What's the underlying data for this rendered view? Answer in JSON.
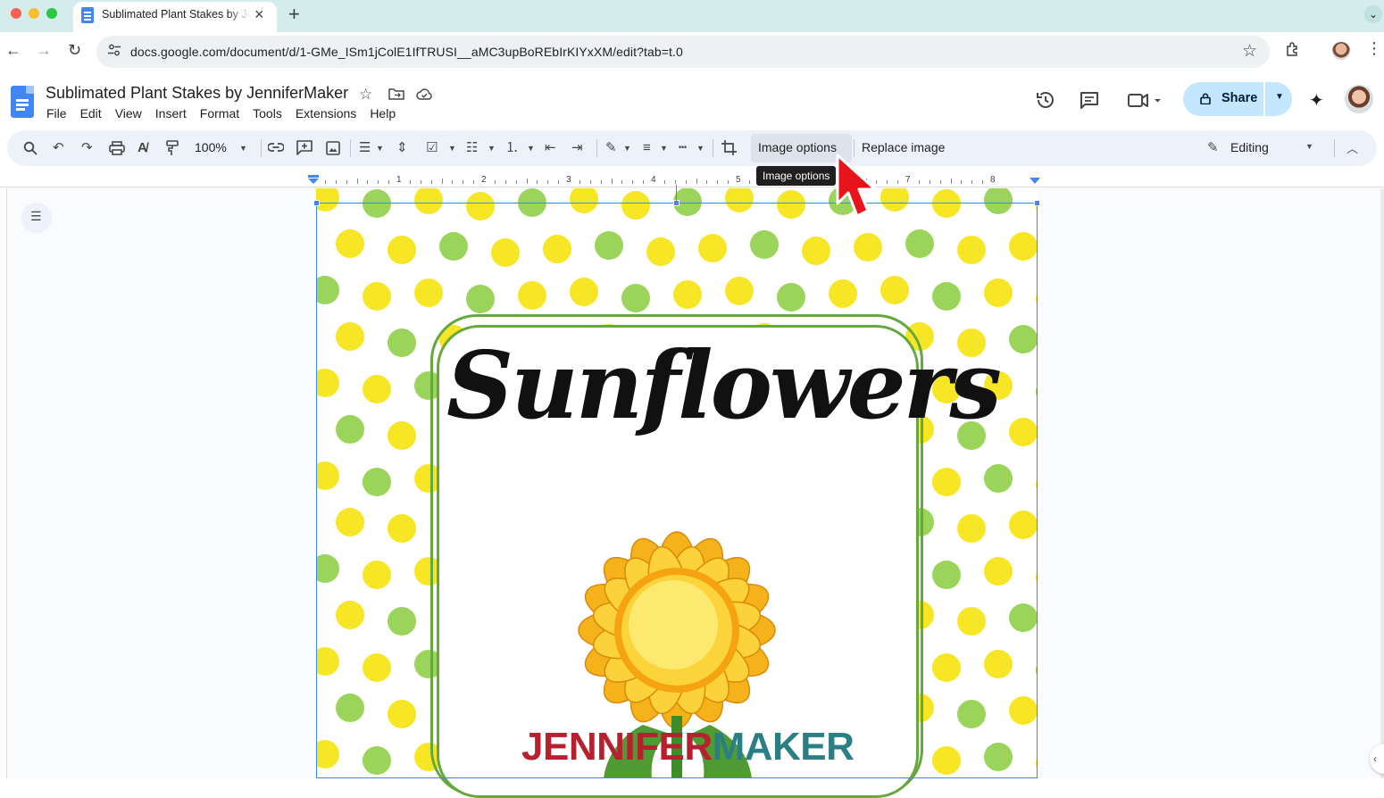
{
  "browser": {
    "tab_title": "Sublimated Plant Stakes by JenniferMaker",
    "url": "docs.google.com/document/d/1-GMe_ISm1jColE1IfTRUSI__aMC3upBoREbIrKIYxXM/edit?tab=t.0"
  },
  "doc": {
    "title": "Sublimated Plant Stakes by JenniferMaker",
    "menu": [
      "File",
      "Edit",
      "View",
      "Insert",
      "Format",
      "Tools",
      "Extensions",
      "Help"
    ],
    "share_label": "Share"
  },
  "toolbar": {
    "zoom": "100%",
    "image_options_label": "Image options",
    "replace_image_label": "Replace image",
    "mode_label": "Editing",
    "tooltip": "Image options"
  },
  "ruler": {
    "numbers": [
      "1",
      "2",
      "3",
      "4",
      "5",
      "6",
      "7",
      "8"
    ]
  },
  "image": {
    "title_text": "Sunflowers",
    "brand_part1": "JENNIFER",
    "brand_part2": "MAKER"
  },
  "colors": {
    "accent_blue": "#4285f4",
    "share_bg": "#c2e7ff",
    "toolbar_bg": "#edf2fa",
    "dot_yellow": "#f7e625",
    "dot_green": "#9ad45a",
    "dot_pale": "#d4edc4",
    "frame_green": "#64a83e",
    "brand_red": "#b7202e",
    "brand_teal": "#2a7f84",
    "cursor_red": "#e8141c"
  }
}
